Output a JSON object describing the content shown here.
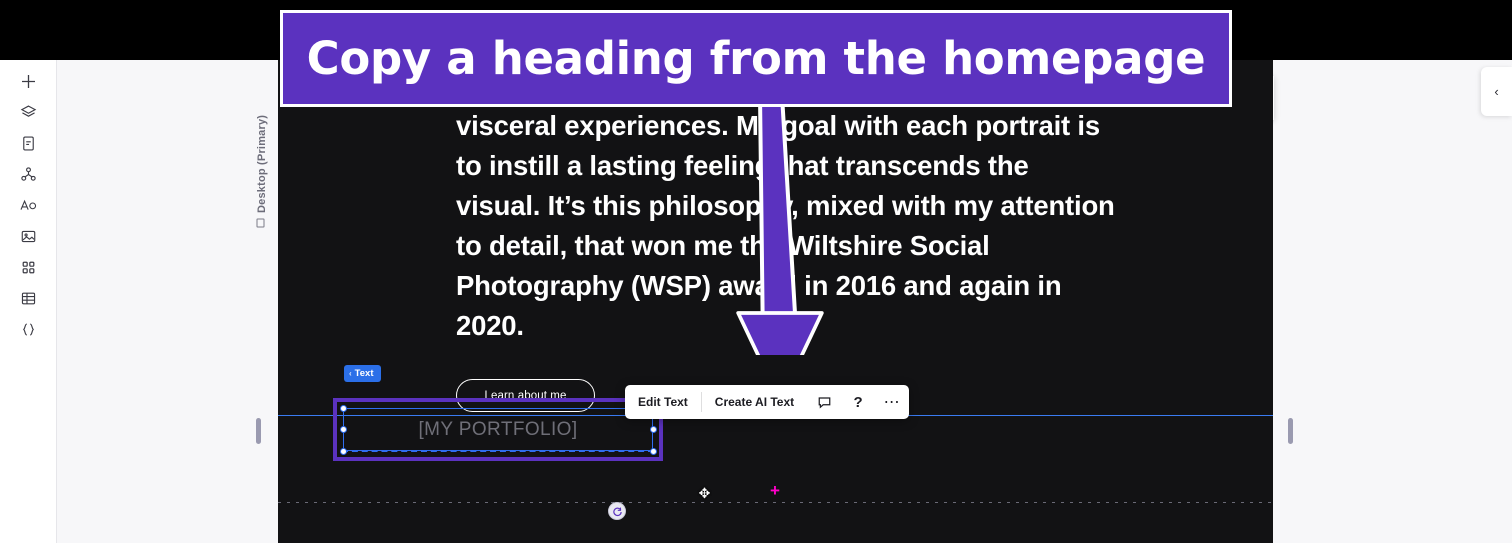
{
  "annotation": {
    "banner_text": "Copy a heading from the homepage",
    "banner_color": "#5b32bf",
    "arrow_color": "#5b32bf"
  },
  "left_rail": {
    "items": [
      {
        "icon": "plus-icon",
        "name": "add-element"
      },
      {
        "icon": "layers-icon",
        "name": "layers"
      },
      {
        "icon": "page-icon",
        "name": "pages"
      },
      {
        "icon": "site-structure-icon",
        "name": "site-structure"
      },
      {
        "icon": "text-ai-icon",
        "name": "text-ai"
      },
      {
        "icon": "image-icon",
        "name": "media"
      },
      {
        "icon": "apps-grid-icon",
        "name": "apps"
      },
      {
        "icon": "table-icon",
        "name": "content-manager"
      },
      {
        "icon": "code-braces-icon",
        "name": "dev-mode"
      }
    ]
  },
  "canvas": {
    "device_label": "Desktop (Primary)",
    "hero_paragraph": "visceral experiences. My goal with each portrait is to instill a lasting feeling that transcends the visual. It’s this philosophy, mixed with my attention to detail, that won me the Wiltshire Social Photography (WSP) award in 2016 and again in 2020.",
    "learn_button": "Learn about me",
    "type_tag": "Text",
    "type_tag_chevron": "‹",
    "selected_text": "[MY PORTFOLIO]",
    "selection_color": "#5b32bf",
    "selection_inner_color": "#2f6ef0",
    "divider_color": "#3a7bf2",
    "cursor_crosshair_color": "#ff00c8"
  },
  "float_toolbar": {
    "edit_text": "Edit Text",
    "create_ai_text": "Create AI Text",
    "comment_icon": "comment-icon",
    "help_icon": "help-icon",
    "more_icon": "more-icon"
  },
  "right_panel": {
    "collapse_chevron": "‹"
  }
}
